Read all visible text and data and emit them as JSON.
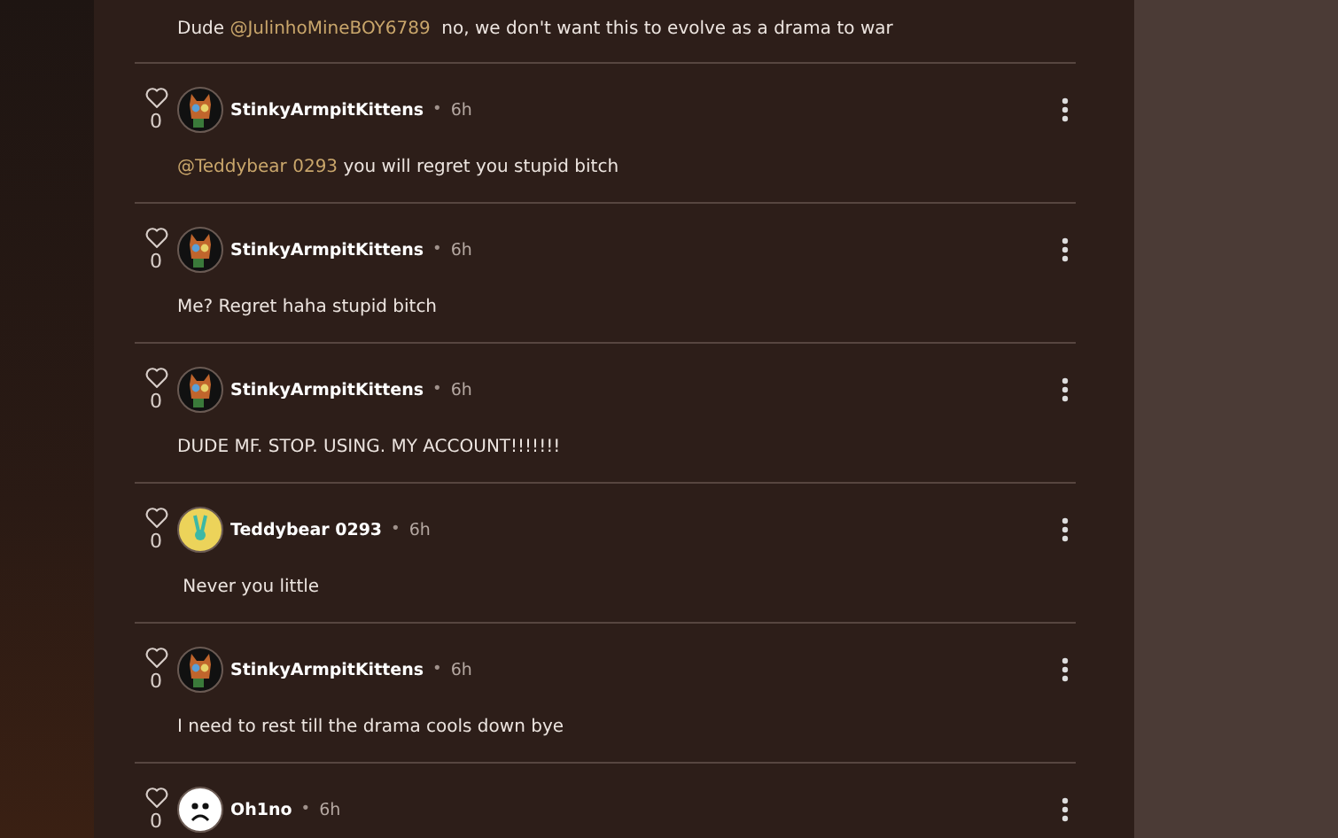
{
  "top_comment": {
    "body": [
      {
        "kind": "plain",
        "text": "Dude "
      },
      {
        "kind": "mention",
        "text": "@JulinhoMineBOY6789"
      },
      {
        "kind": "plain",
        "text": "  no, we don't want this to evolve as a drama to war"
      }
    ]
  },
  "comments": [
    {
      "likes": "0",
      "liked": false,
      "kind": "cat",
      "author": "StinkyArmpitKittens",
      "separator": "•",
      "time": "6h",
      "body": [
        {
          "kind": "mention",
          "text": "@Teddybear 0293"
        },
        {
          "kind": "plain",
          "text": " you will regret you stupid bitch"
        }
      ]
    },
    {
      "likes": "0",
      "liked": false,
      "kind": "cat",
      "author": "StinkyArmpitKittens",
      "separator": "•",
      "time": "6h",
      "body": [
        {
          "kind": "plain",
          "text": "Me? Regret haha stupid bitch"
        }
      ]
    },
    {
      "likes": "0",
      "liked": false,
      "kind": "cat",
      "author": "StinkyArmpitKittens",
      "separator": "•",
      "time": "6h",
      "body": [
        {
          "kind": "plain",
          "text": "DUDE MF. STOP. USING. MY ACCOUNT!!!!!!!"
        }
      ]
    },
    {
      "likes": "0",
      "liked": false,
      "kind": "bunny",
      "author": "Teddybear 0293",
      "separator": "•",
      "time": "6h",
      "body": [
        {
          "kind": "plain",
          "text": " Never you little"
        }
      ]
    },
    {
      "likes": "0",
      "liked": false,
      "kind": "cat",
      "author": "StinkyArmpitKittens",
      "separator": "•",
      "time": "6h",
      "body": [
        {
          "kind": "plain",
          "text": "I need to rest till the drama cools down bye"
        }
      ]
    },
    {
      "likes": "0",
      "liked": false,
      "kind": "sad",
      "author": "Oh1no",
      "separator": "•",
      "time": "6h"
    }
  ]
}
